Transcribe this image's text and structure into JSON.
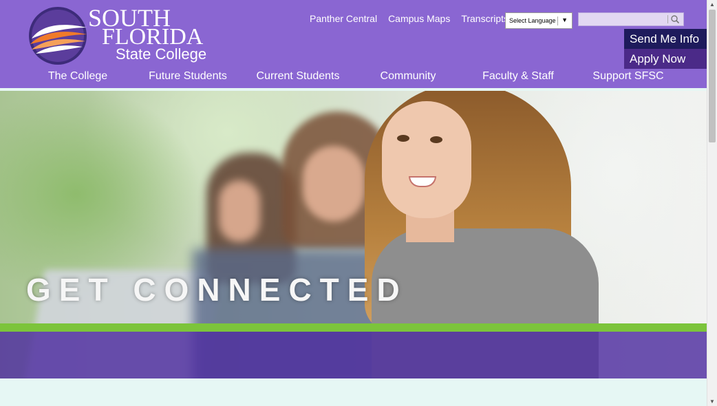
{
  "logo": {
    "line1": "SOUTH",
    "line2": "FLORIDA",
    "line3": "State College"
  },
  "top_links": [
    "Panther Central",
    "Campus Maps",
    "Transcripts"
  ],
  "language": {
    "label": "Select Language",
    "arrow": "▼"
  },
  "search": {
    "placeholder": ""
  },
  "cta": {
    "send_info": "Send Me Info",
    "apply": "Apply Now"
  },
  "nav": [
    "The College",
    "Future Students",
    "Current Students",
    "Community",
    "Faculty & Staff",
    "Support SFSC"
  ],
  "hero": {
    "headline": "GET CONNECTED"
  },
  "colors": {
    "header": "#8a66d2",
    "cta_dark": "#1e1b5c",
    "cta_purple": "#4b2a88",
    "green": "#7cc43b",
    "band": "#4e2da0",
    "footer_bg": "#e6f7f4"
  },
  "icons": {
    "search": "magnifier-icon",
    "logo_swirl": "sfsc-logo-swirl"
  }
}
